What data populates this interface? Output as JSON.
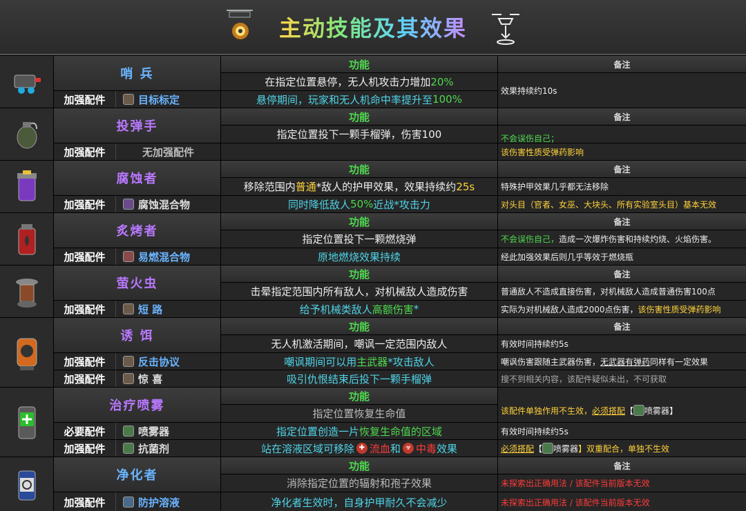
{
  "title": "主动技能及其效果",
  "func_head": "功能",
  "note_head": "备注",
  "part_label_strengthen": "加强配件",
  "part_label_required": "必要配件",
  "skills": [
    {
      "name": "哨 兵",
      "part": "目标标定",
      "func_main_a": "在指定位置悬停，无人机攻击力增加",
      "func_main_b": "20%",
      "func_part": "悬停期间，玩家和无人机命中率提升至",
      "func_part_b": "100%",
      "note_main": "效果持续约10s",
      "note_part": ""
    },
    {
      "name": "投弹手",
      "part": "无加强配件",
      "func_main": "指定位置投下一颗手榴弹，伤害100",
      "note_main": "不会误伤自己；",
      "note_part": "该伤害性质受弹药影响"
    },
    {
      "name": "腐蚀者",
      "part": "腐蚀混合物",
      "func_main_a": "移除范围内",
      "func_main_b": "普通",
      "func_main_c": "*敌人的护甲效果，效果持续约",
      "func_main_d": "25s",
      "func_part_a": "同时降低敌人",
      "func_part_b": "50%",
      "func_part_c": "近战",
      "func_part_d": "*攻击力",
      "note_main": "特殊护甲效果几乎都无法移除",
      "note_part": "对头目（官者、女巫、大块头、所有实验室头目）基本无效"
    },
    {
      "name": "炙烤者",
      "part": "易燃混合物",
      "func_main": "指定位置投下一颗燃烧弹",
      "func_part": "原地燃烧效果持续",
      "note_main_a": "不会误伤自己，",
      "note_main_b": "造成一次爆炸伤害和持续灼烧、火焰伤害。",
      "note_part": "经此加强效果后则几乎等效于燃烧瓶"
    },
    {
      "name": "萤火虫",
      "part": "短 路",
      "func_main": "击晕指定范围内所有敌人，对机械敌人造成伤害",
      "func_part_a": "给予机械类敌人",
      "func_part_b": "高额伤害",
      "func_part_c": "*",
      "note_main": "普通敌人不造成直接伤害，对机械敌人造成普通伤害100点",
      "note_part_a": "实际为对机械敌人造成2000点伤害，",
      "note_part_b": "该伤害性质受弹药影响"
    },
    {
      "name": "诱 饵",
      "part": "反击协议",
      "part2": "惊 喜",
      "func_main": "无人机激活期间，嘲讽一定范围内敌人",
      "func_part_a": "嘲讽期间可以用",
      "func_part_b": "主武器",
      "func_part_c": "*攻击敌人",
      "func_part2": "吸引仇恨结束后投下一颗手榴弹",
      "note_main": "有效时间持续约5s",
      "note_part_a": "嘲讽伤害跟随主武器伤害，",
      "note_part_b": "无武器有弹药",
      "note_part_c": "同样有一定效果",
      "note_part2": "搜不到相关内容，该配件疑似未出，不可获取"
    },
    {
      "name": "治疗喷雾",
      "part_req": "喷雾器",
      "part": "抗菌剂",
      "func_main": "指定位置恢复生命值",
      "func_req_a": "指定位置创造一片",
      "func_req_b": "恢复生命值的区域",
      "func_part_a": "站在溶液区域可移除",
      "func_part_b": "流血",
      "func_part_c": "和",
      "func_part_d": "中毒",
      "func_part_e": "效果",
      "note_main_a": "该配件单独作用不生效，",
      "note_main_b": "必须搭配",
      "note_main_c": "【",
      "note_main_d": "喷雾器",
      "note_main_e": "】",
      "note_req": "有效时间持续约5s",
      "note_part_a": "必须搭配",
      "note_part_b": "【",
      "note_part_c": "喷雾器",
      "note_part_d": "】双重配合，单独不生效"
    },
    {
      "name": "净化者",
      "part": "防护溶液",
      "func_main": "消除指定位置的辐射和孢子效果",
      "func_part": "净化者生效时，自身护甲耐久不会减少",
      "note_main": "未探索出正确用法 / 该配件当前版本无效",
      "note_part": "未探索出正确用法 / 该配件当前版本无效"
    }
  ]
}
